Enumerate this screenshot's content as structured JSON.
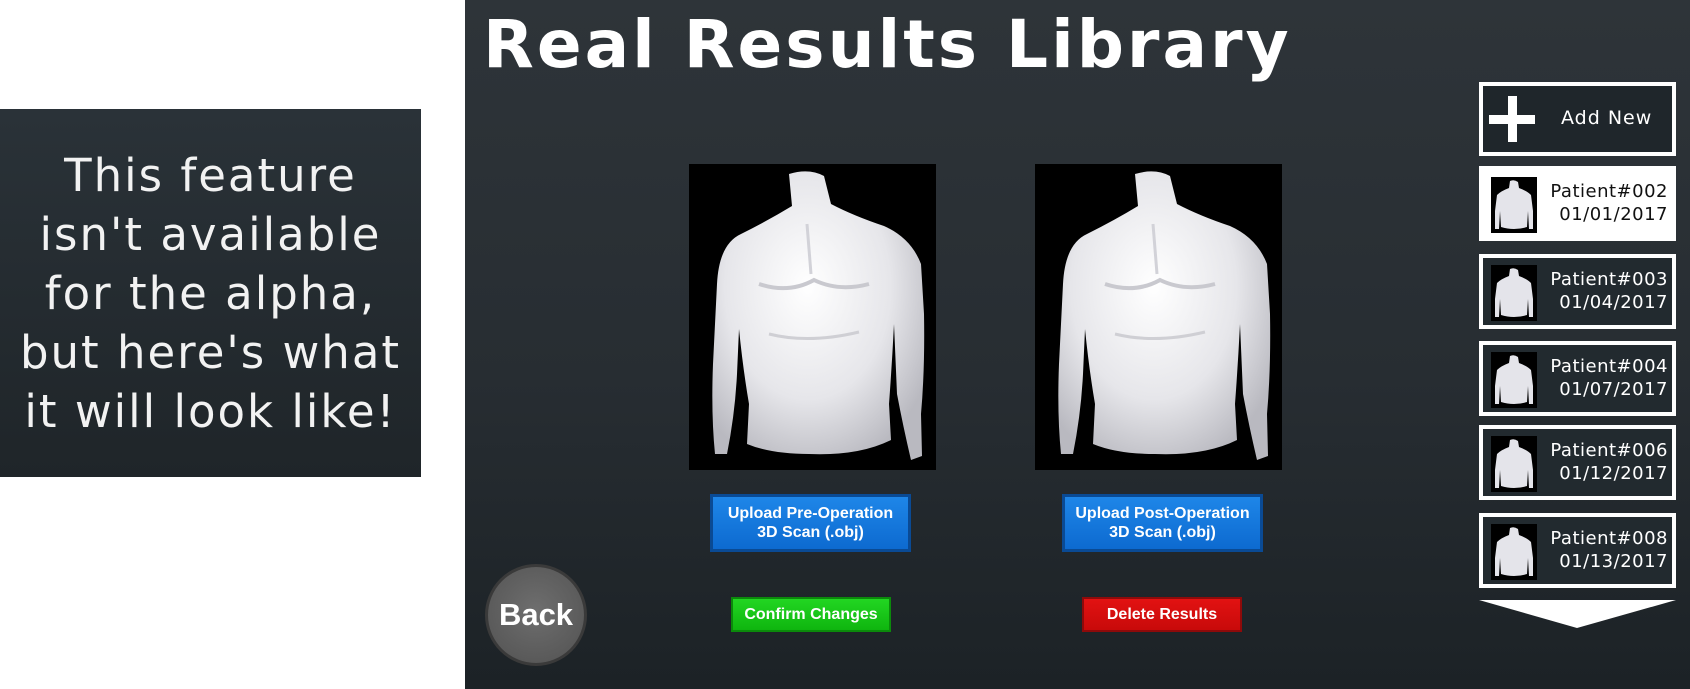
{
  "notice": {
    "text": "This feature isn't available for the alpha, but here's what it will look like!"
  },
  "header": {
    "title": "Real Results Library"
  },
  "scans": {
    "pre_upload_label": "Upload Pre-Operation\n3D Scan (.obj)",
    "post_upload_label": "Upload Post-Operation\n3D Scan (.obj)"
  },
  "actions": {
    "back_label": "Back",
    "confirm_label": "Confirm Changes",
    "delete_label": "Delete Results"
  },
  "sidebar": {
    "add_new_label": "Add New",
    "patients": [
      {
        "name": "Patient#002",
        "date": "01/01/2017",
        "selected": true
      },
      {
        "name": "Patient#003",
        "date": "01/04/2017",
        "selected": false
      },
      {
        "name": "Patient#004",
        "date": "01/07/2017",
        "selected": false
      },
      {
        "name": "Patient#006",
        "date": "01/12/2017",
        "selected": false
      },
      {
        "name": "Patient#008",
        "date": "01/13/2017",
        "selected": false
      }
    ]
  },
  "colors": {
    "upload_blue": "#0d6ad0",
    "confirm_green": "#10b810",
    "delete_red": "#d40d0d"
  },
  "icons": {
    "add": "plus-icon",
    "scroll": "chevron-down-icon"
  }
}
